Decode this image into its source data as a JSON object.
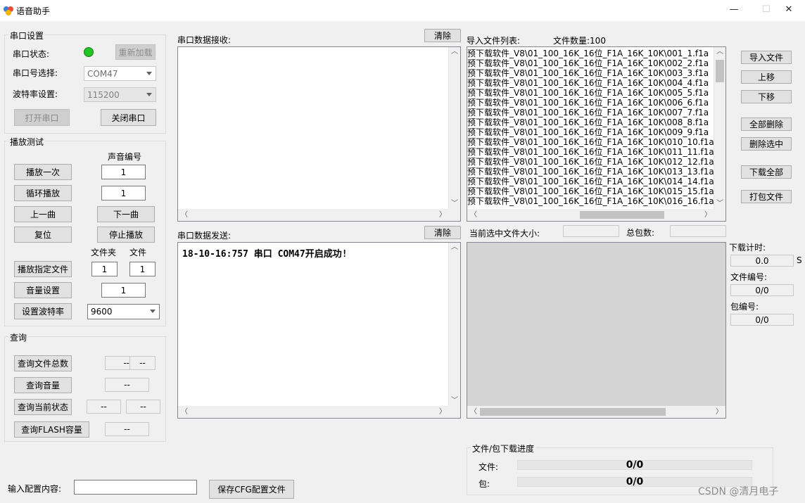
{
  "window": {
    "title": "语音助手",
    "minimize_glyph": "—",
    "maximize_glyph": "☐",
    "close_glyph": "✕"
  },
  "serial_settings": {
    "group_label": "串口设置",
    "status_label": "串口状态:",
    "status_color": "#22c322",
    "reload_button": "重新加载",
    "port_label": "串口号选择:",
    "port_value": "COM47",
    "baud_label": "波特率设置:",
    "baud_value": "115200",
    "open_button": "打开串口",
    "close_button": "关闭串口"
  },
  "playback": {
    "group_label": "播放测试",
    "sound_number_label": "声音编号",
    "play_once_button": "播放一次",
    "play_once_value": "1",
    "loop_button": "循环播放",
    "loop_value": "1",
    "prev_button": "上一曲",
    "next_button": "下一曲",
    "reset_button": "复位",
    "stop_button": "停止播放",
    "folder_label": "文件夹",
    "file_label": "文件",
    "play_specified_button": "播放指定文件",
    "folder_value": "1",
    "file_value": "1",
    "volume_button": "音量设置",
    "volume_value": "1",
    "set_baud_button": "设置波特率",
    "baud_select_value": "9600"
  },
  "query": {
    "group_label": "查询",
    "total_files_button": "查询文件总数",
    "total_files_value_a": "--",
    "total_files_value_b": "--",
    "volume_button": "查询音量",
    "volume_value": "--",
    "status_button": "查询当前状态",
    "status_value_a": "--",
    "status_value_b": "--",
    "flash_button": "查询FLASH容量",
    "flash_value": "--"
  },
  "receive": {
    "label": "串口数据接收:",
    "clear_button": "清除"
  },
  "send": {
    "label": "串口数据发送:",
    "clear_button": "清除",
    "content": "18-10-16:757 串口 COM47开启成功!"
  },
  "file_list": {
    "label": "导入文件列表:",
    "count_label": "文件数量:100",
    "items": [
      "预下载软件_V8\\01_100_16K_16位_F1A_16K_10K\\001_1.f1a",
      "预下载软件_V8\\01_100_16K_16位_F1A_16K_10K\\002_2.f1a",
      "预下载软件_V8\\01_100_16K_16位_F1A_16K_10K\\003_3.f1a",
      "预下载软件_V8\\01_100_16K_16位_F1A_16K_10K\\004_4.f1a",
      "预下载软件_V8\\01_100_16K_16位_F1A_16K_10K\\005_5.f1a",
      "预下载软件_V8\\01_100_16K_16位_F1A_16K_10K\\006_6.f1a",
      "预下载软件_V8\\01_100_16K_16位_F1A_16K_10K\\007_7.f1a",
      "预下载软件_V8\\01_100_16K_16位_F1A_16K_10K\\008_8.f1a",
      "预下载软件_V8\\01_100_16K_16位_F1A_16K_10K\\009_9.f1a",
      "预下载软件_V8\\01_100_16K_16位_F1A_16K_10K\\010_10.f1a",
      "预下载软件_V8\\01_100_16K_16位_F1A_16K_10K\\011_11.f1a",
      "预下载软件_V8\\01_100_16K_16位_F1A_16K_10K\\012_12.f1a",
      "预下载软件_V8\\01_100_16K_16位_F1A_16K_10K\\013_13.f1a",
      "预下载软件_V8\\01_100_16K_16位_F1A_16K_10K\\014_14.f1a",
      "预下载软件_V8\\01_100_16K_16位_F1A_16K_10K\\015_15.f1a",
      "预下载软件_V8\\01_100_16K_16位_F1A_16K_10K\\016_16.f1a"
    ]
  },
  "right_buttons": {
    "import": "导入文件",
    "move_up": "上移",
    "move_down": "下移",
    "delete_all": "全部删除",
    "delete_selected": "删除选中",
    "download_all": "下载全部",
    "pack": "打包文件"
  },
  "selected_file": {
    "size_label": "当前选中文件大小:",
    "size_value": "",
    "packets_label": "总包数:",
    "packets_value": ""
  },
  "download_info": {
    "timer_label": "下载计时:",
    "timer_value": "0.0",
    "timer_unit": "S",
    "file_no_label": "文件编号:",
    "file_no_value": "0/0",
    "packet_no_label": "包编号:",
    "packet_no_value": "0/0"
  },
  "progress": {
    "group_label": "文件/包下载进度",
    "file_label": "文件:",
    "file_value": "0/0",
    "file_fraction": 0,
    "packet_label": "包:",
    "packet_value": "0/0",
    "packet_fraction": 0
  },
  "config": {
    "input_label": "输入配置内容:",
    "input_value": "",
    "save_button": "保存CFG配置文件"
  },
  "watermark": "CSDN @清月电子"
}
